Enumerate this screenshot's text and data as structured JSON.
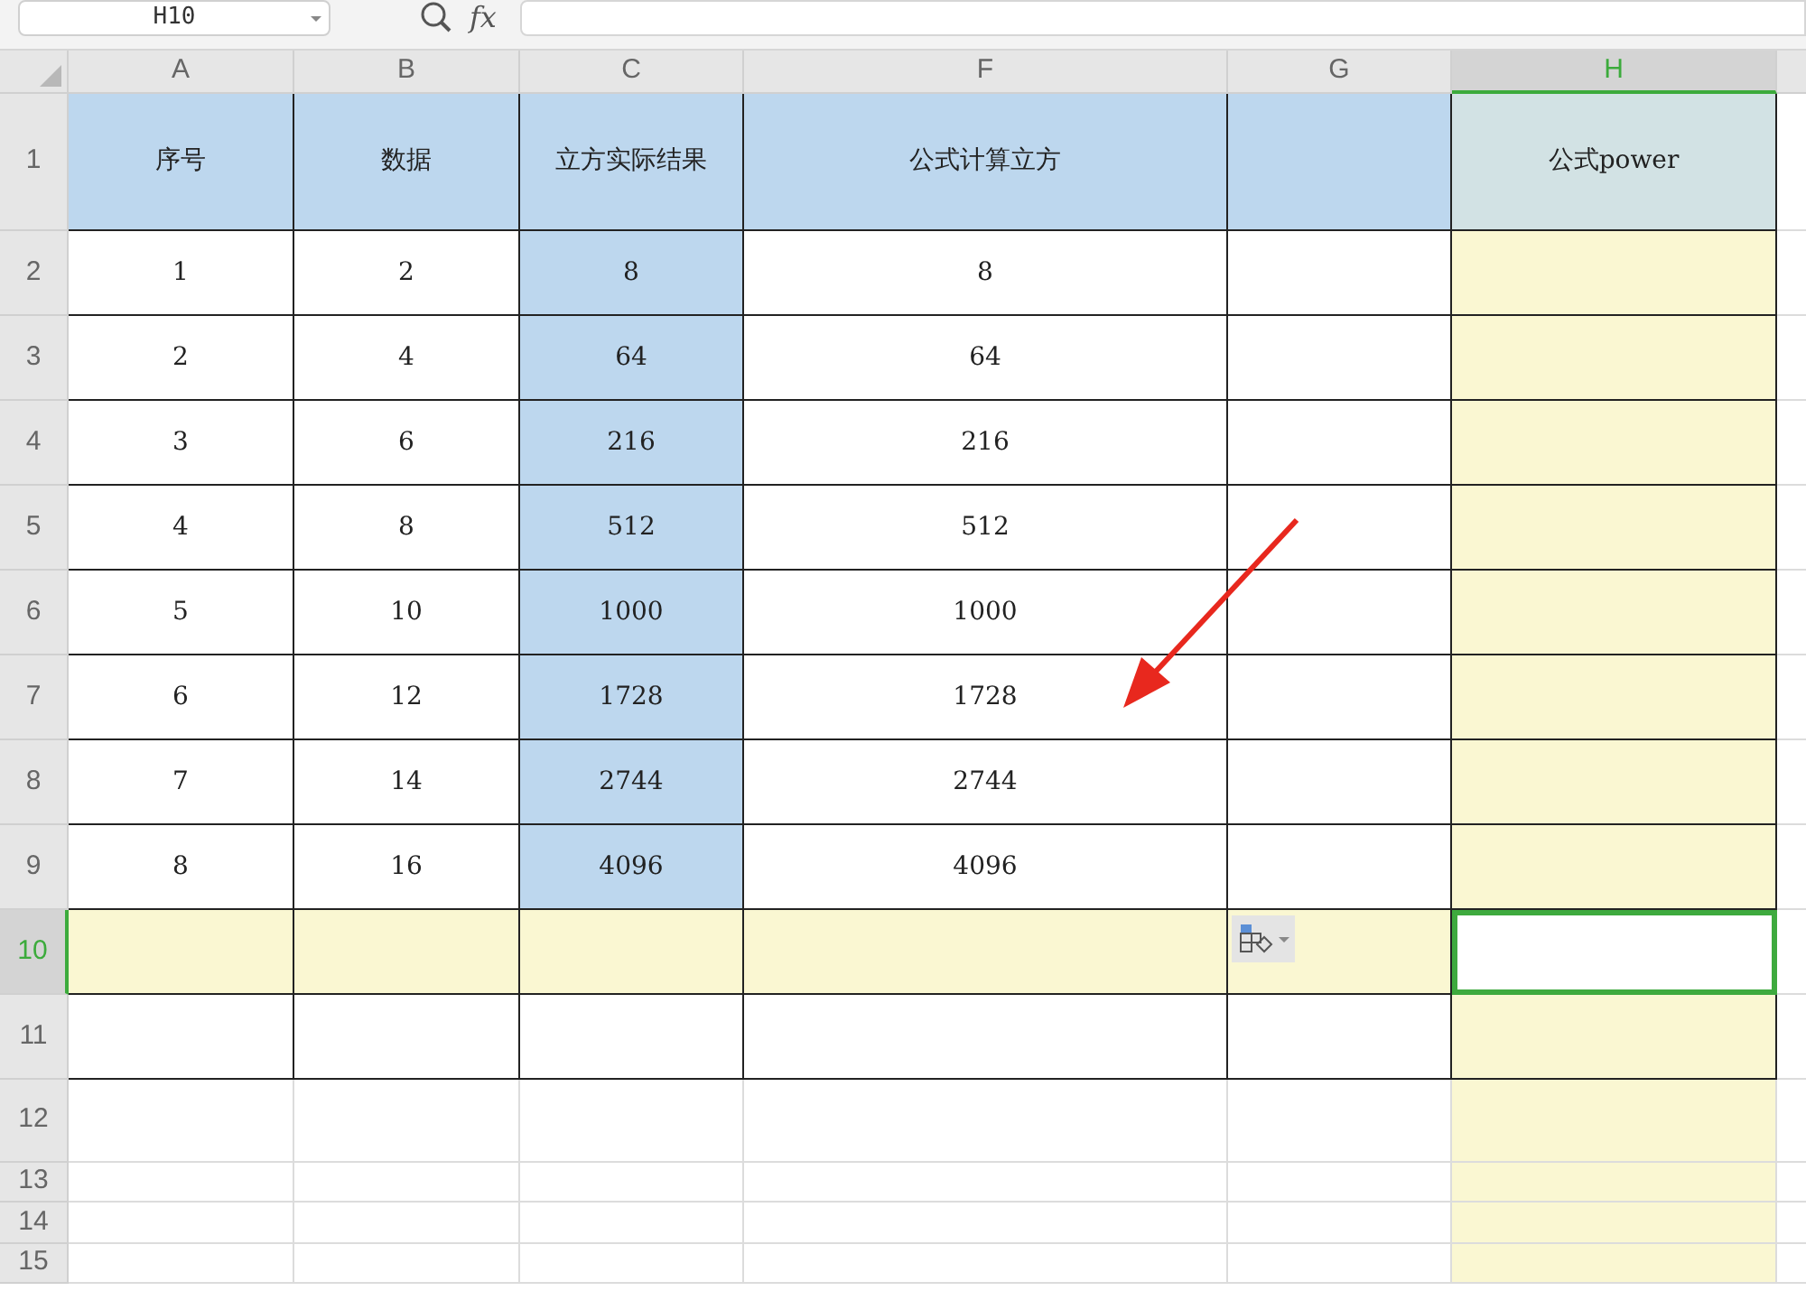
{
  "formula_bar": {
    "name_box": "H10",
    "function_label": "fx"
  },
  "columns": [
    {
      "letter": "A",
      "selected": false
    },
    {
      "letter": "B",
      "selected": false
    },
    {
      "letter": "C",
      "selected": false
    },
    {
      "letter": "F",
      "selected": false
    },
    {
      "letter": "G",
      "selected": false
    },
    {
      "letter": "H",
      "selected": true
    }
  ],
  "rows": [
    {
      "number": "1",
      "selected": false,
      "bordered": true,
      "cells": [
        {
          "text": "序号",
          "color": "#bdd7ee"
        },
        {
          "text": "数据",
          "color": "#bdd7ee"
        },
        {
          "text": "立方实际结果",
          "color": "#bdd7ee"
        },
        {
          "text": "公式计算立方",
          "color": "#bdd7ee"
        },
        {
          "color": "#bdd7ee"
        },
        {
          "text": "公式power",
          "color": "#d2e2e4"
        }
      ]
    },
    {
      "number": "2",
      "selected": false,
      "bordered": true,
      "cells": [
        {
          "text": "1"
        },
        {
          "text": "2"
        },
        {
          "text": "8",
          "color": "#bdd7ee"
        },
        {
          "text": "8"
        },
        {},
        {
          "color": "#faf7d2"
        }
      ]
    },
    {
      "number": "3",
      "selected": false,
      "bordered": true,
      "cells": [
        {
          "text": "2"
        },
        {
          "text": "4"
        },
        {
          "text": "64",
          "color": "#bdd7ee"
        },
        {
          "text": "64"
        },
        {},
        {
          "color": "#faf7d2"
        }
      ]
    },
    {
      "number": "4",
      "selected": false,
      "bordered": true,
      "cells": [
        {
          "text": "3"
        },
        {
          "text": "6"
        },
        {
          "text": "216",
          "color": "#bdd7ee"
        },
        {
          "text": "216"
        },
        {},
        {
          "color": "#faf7d2"
        }
      ]
    },
    {
      "number": "5",
      "selected": false,
      "bordered": true,
      "cells": [
        {
          "text": "4"
        },
        {
          "text": "8"
        },
        {
          "text": "512",
          "color": "#bdd7ee"
        },
        {
          "text": "512"
        },
        {},
        {
          "color": "#faf7d2"
        }
      ]
    },
    {
      "number": "6",
      "selected": false,
      "bordered": true,
      "cells": [
        {
          "text": "5"
        },
        {
          "text": "10"
        },
        {
          "text": "1000",
          "color": "#bdd7ee"
        },
        {
          "text": "1000"
        },
        {},
        {
          "color": "#faf7d2"
        }
      ]
    },
    {
      "number": "7",
      "selected": false,
      "bordered": true,
      "cells": [
        {
          "text": "6"
        },
        {
          "text": "12"
        },
        {
          "text": "1728",
          "color": "#bdd7ee"
        },
        {
          "text": "1728"
        },
        {},
        {
          "color": "#faf7d2"
        }
      ]
    },
    {
      "number": "8",
      "selected": false,
      "bordered": true,
      "cells": [
        {
          "text": "7"
        },
        {
          "text": "14"
        },
        {
          "text": "2744",
          "color": "#bdd7ee"
        },
        {
          "text": "2744"
        },
        {},
        {
          "color": "#faf7d2"
        }
      ]
    },
    {
      "number": "9",
      "selected": false,
      "bordered": true,
      "cells": [
        {
          "text": "8"
        },
        {
          "text": "16"
        },
        {
          "text": "4096",
          "color": "#bdd7ee"
        },
        {
          "text": "4096"
        },
        {},
        {
          "color": "#faf7d2"
        }
      ]
    },
    {
      "number": "10",
      "selected": true,
      "bordered": true,
      "cells": [
        {
          "color": "#faf7d2"
        },
        {
          "color": "#faf7d2"
        },
        {
          "color": "#faf7d2"
        },
        {
          "color": "#faf7d2"
        },
        {
          "color": "#faf7d2"
        },
        {
          "active": true
        }
      ]
    },
    {
      "number": "11",
      "selected": false,
      "bordered": true,
      "cells": [
        {},
        {},
        {},
        {},
        {},
        {
          "color": "#faf7d2"
        }
      ]
    },
    {
      "number": "12",
      "selected": false,
      "bordered": false,
      "cells": [
        {},
        {},
        {},
        {},
        {},
        {
          "color": "#faf7d2"
        }
      ]
    },
    {
      "number": "13",
      "selected": false,
      "bordered": false,
      "cells": [
        {},
        {},
        {},
        {},
        {},
        {
          "color": "#faf7d2"
        }
      ]
    },
    {
      "number": "14",
      "selected": false,
      "bordered": false,
      "cells": [
        {},
        {},
        {},
        {},
        {},
        {
          "color": "#faf7d2"
        }
      ]
    },
    {
      "number": "15",
      "selected": false,
      "bordered": false,
      "cells": [
        {},
        {},
        {},
        {},
        {},
        {
          "color": "#faf7d2"
        }
      ]
    }
  ]
}
